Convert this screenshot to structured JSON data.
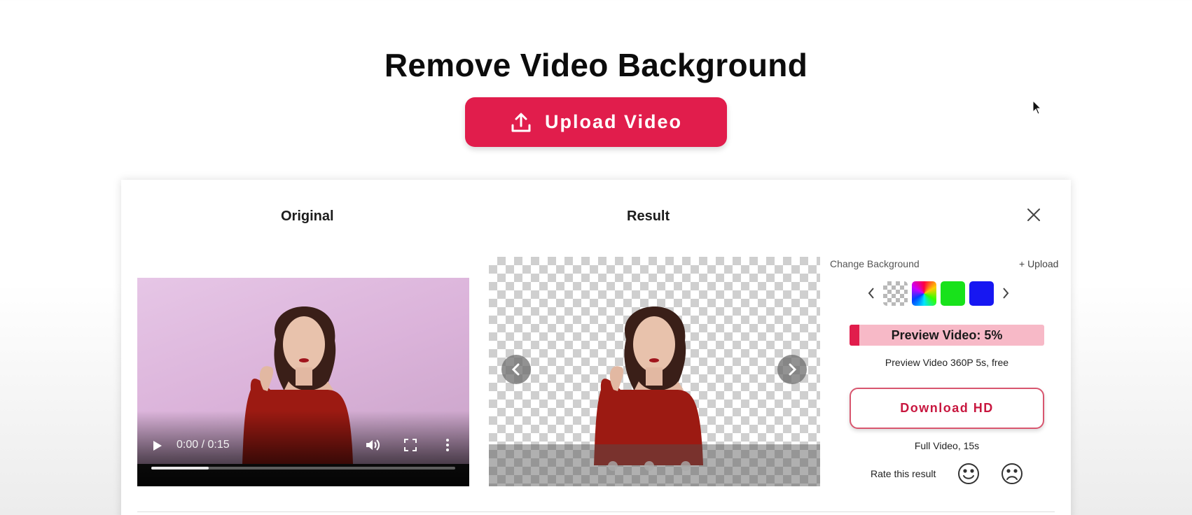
{
  "page": {
    "title": "Remove Video Background",
    "upload_button": "Upload Video"
  },
  "panel": {
    "original_title": "Original",
    "result_title": "Result",
    "video": {
      "time": "0:00 / 0:15",
      "progress": 0.19
    },
    "result": {
      "slide_count": 3
    },
    "sidebar": {
      "change_background_label": "Change Background",
      "upload_link": "+ Upload",
      "swatches": [
        {
          "name": "transparent"
        },
        {
          "name": "rainbow"
        },
        {
          "name": "green",
          "color": "#18e21b"
        },
        {
          "name": "blue",
          "color": "#1717f2"
        }
      ],
      "preview": {
        "label": "Preview Video: 5%",
        "percent": 5,
        "subtext": "Preview Video 360P 5s, free"
      },
      "download_button": "Download HD",
      "full_video_text": "Full Video, 15s",
      "rate_label": "Rate this result"
    }
  },
  "colors": {
    "accent": "#e11d4c",
    "preview_track": "#f7b9c7"
  }
}
